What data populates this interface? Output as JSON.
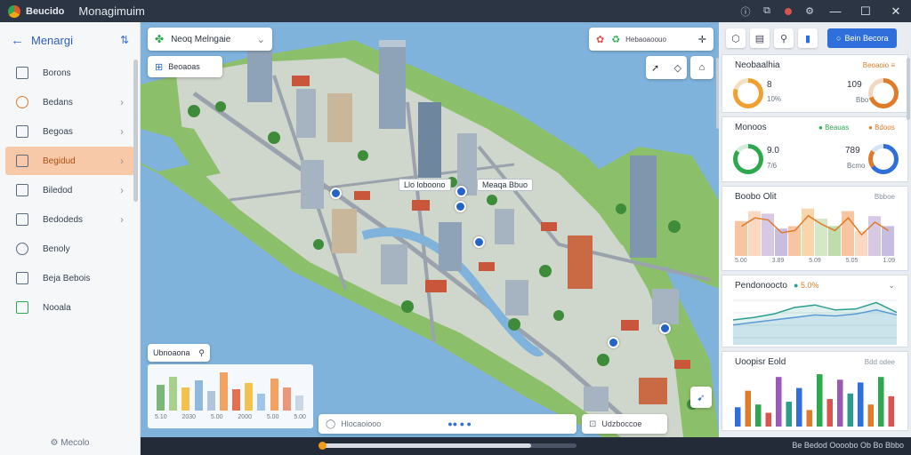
{
  "titlebar": {
    "app_name": "Beucido",
    "window_title": "Monagimuim"
  },
  "sidebar": {
    "back_icon": "arrow-left-icon",
    "title": "Menargi",
    "items": [
      {
        "label": "Borons",
        "icon": "square-icon",
        "chevron": false,
        "active": false
      },
      {
        "label": "Bedans",
        "icon": "circle-icon",
        "chevron": true,
        "active": false
      },
      {
        "label": "Begoas",
        "icon": "monitor-icon",
        "chevron": true,
        "active": false
      },
      {
        "label": "Begidud",
        "icon": "square-icon",
        "chevron": true,
        "active": true
      },
      {
        "label": "Biledod",
        "icon": "square-icon",
        "chevron": true,
        "active": false
      },
      {
        "label": "Bedodeds",
        "icon": "building-icon",
        "chevron": true,
        "active": false
      },
      {
        "label": "Benoly",
        "icon": "circle-icon",
        "chevron": false,
        "active": false
      },
      {
        "label": "Beja Bebois",
        "icon": "square-icon",
        "chevron": false,
        "active": false
      },
      {
        "label": "Nooala",
        "icon": "home-icon",
        "chevron": false,
        "active": false
      }
    ],
    "footer": "Mecolo"
  },
  "map": {
    "layer_select": {
      "label": "Neoq Melngaie"
    },
    "search_chip": {
      "label": "Beoaoas"
    },
    "toolbar": {
      "label": "Hebaoaoouo"
    },
    "callouts": [
      "Llo loboono",
      "Meaqa Bbuo"
    ],
    "legend_card": {
      "title": "Ubnoaona",
      "labels": [
        "5.10",
        "2030",
        "5.00",
        "2000",
        "5.00",
        "5.00"
      ]
    },
    "search_bar": {
      "placeholder": "Hlocaoiooo"
    },
    "filter_bar": {
      "label": "Udzboccoe"
    }
  },
  "bottom": {
    "progress": 0.82,
    "status": "Be Bedod Oooobo Ob  Bo  Bbbo"
  },
  "right_panel": {
    "primary_button": "Bein Becora",
    "panels": [
      {
        "title": "Neobaalhia",
        "subtitle": "Beoaoio ≡",
        "value_a": "8",
        "pct_a": "10%",
        "value_b": "109",
        "sub_b": "Bbo"
      },
      {
        "title": "Monoos",
        "subtitle_a": "Beauas",
        "subtitle_b": "Bdoos",
        "value_a": "9.0",
        "pct_a": "7/6",
        "value_b": "789",
        "sub_b": "Bcmo"
      },
      {
        "title": "Boobo Olit",
        "subtitle": "Bbboe",
        "ticks": [
          "5.00",
          "3.89",
          "5.09",
          "5.05",
          "1.09"
        ]
      },
      {
        "title": "Pendonoocto",
        "subtitle": "5.0%",
        "value_label": ""
      },
      {
        "title": "Uoopisr Eold",
        "subtitle": "Bdd odee"
      }
    ]
  },
  "colors": {
    "accent": "#2f6fdc",
    "orange": "#e07b2a",
    "green": "#2ea84f",
    "active_bg": "#f8c9a8",
    "titlebar": "#2c3544"
  },
  "legend_bars": [
    0.6,
    0.8,
    0.55,
    0.7,
    0.45,
    0.9,
    0.5,
    0.65,
    0.4,
    0.75,
    0.55,
    0.35
  ],
  "area_chart": [
    0.7,
    0.9,
    0.85,
    0.55,
    0.6,
    0.95,
    0.75,
    0.6,
    0.9,
    0.5,
    0.8,
    0.6
  ],
  "line_chart_a": [
    0.5,
    0.55,
    0.62,
    0.75,
    0.8,
    0.7,
    0.72,
    0.85,
    0.65
  ],
  "line_chart_b": [
    0.4,
    0.45,
    0.5,
    0.55,
    0.6,
    0.58,
    0.62,
    0.7,
    0.6
  ],
  "bar_chart": [
    0.35,
    0.65,
    0.4,
    0.25,
    0.9,
    0.45,
    0.7,
    0.3,
    0.95,
    0.5,
    0.85,
    0.6,
    0.8,
    0.4,
    0.9,
    0.55
  ]
}
